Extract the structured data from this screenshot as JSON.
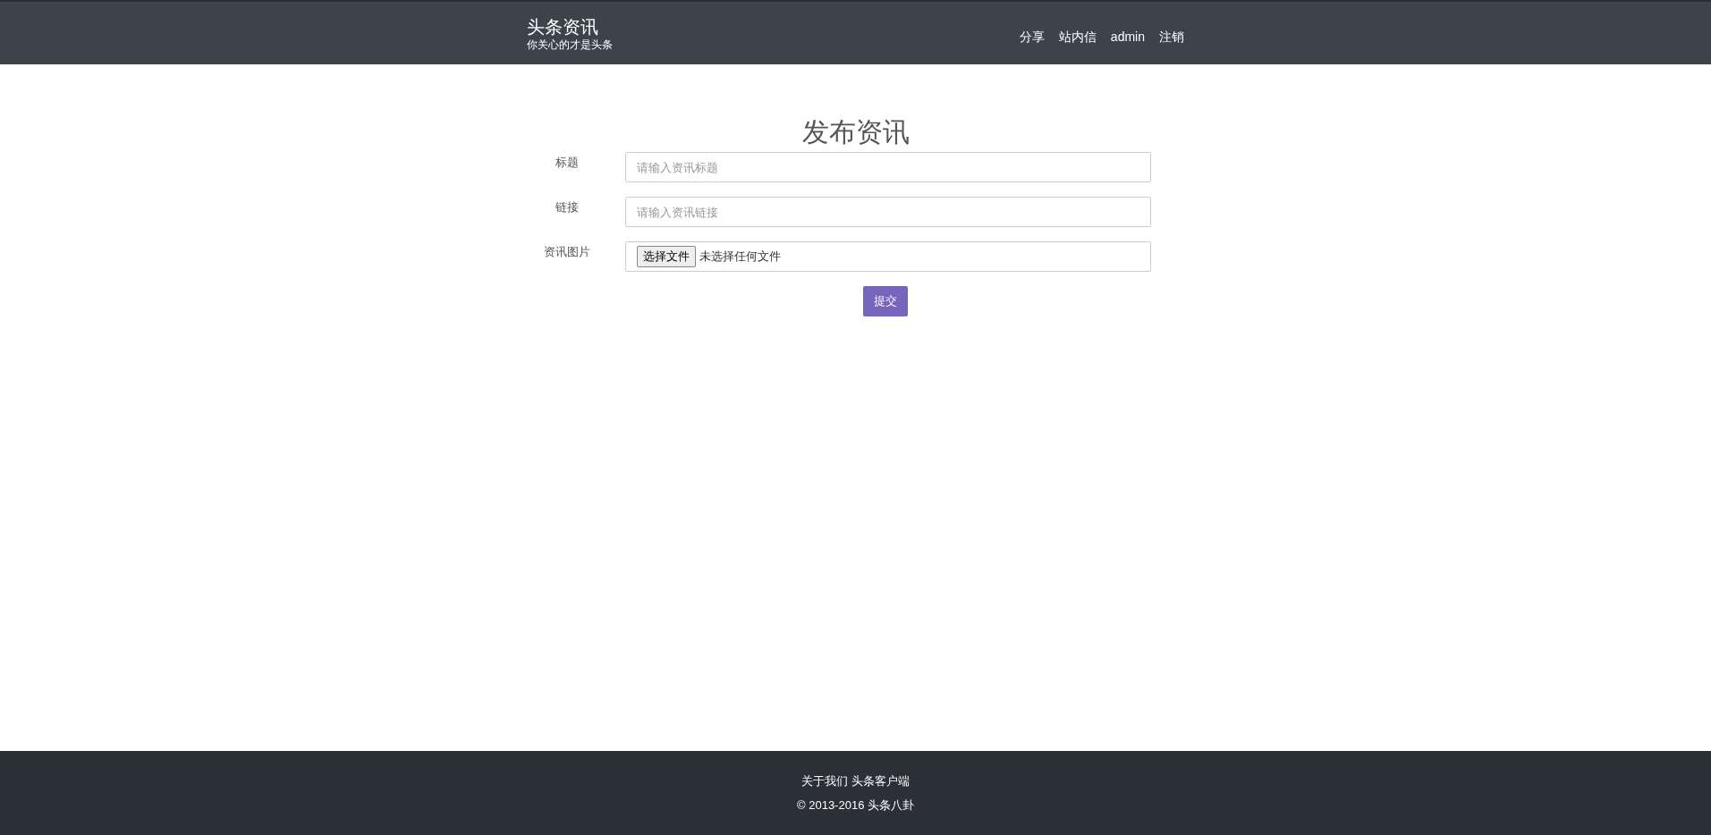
{
  "brand": {
    "title": "头条资讯",
    "tagline": "你关心的才是头条"
  },
  "nav": [
    "分享",
    "站内信",
    "admin",
    "注销"
  ],
  "form": {
    "heading": "发布资讯",
    "fields": [
      {
        "kind": "text",
        "label": "标题",
        "placeholder": "请输入资讯标题"
      },
      {
        "kind": "text",
        "label": "链接",
        "placeholder": "请输入资讯链接"
      },
      {
        "kind": "file",
        "label": "资讯图片",
        "button": "选择文件",
        "status": "未选择任何文件"
      }
    ],
    "submit": "提交"
  },
  "footer": {
    "links": [
      "关于我们",
      "头条客户端"
    ],
    "copyright": "© 2013-2016 头条八卦"
  }
}
